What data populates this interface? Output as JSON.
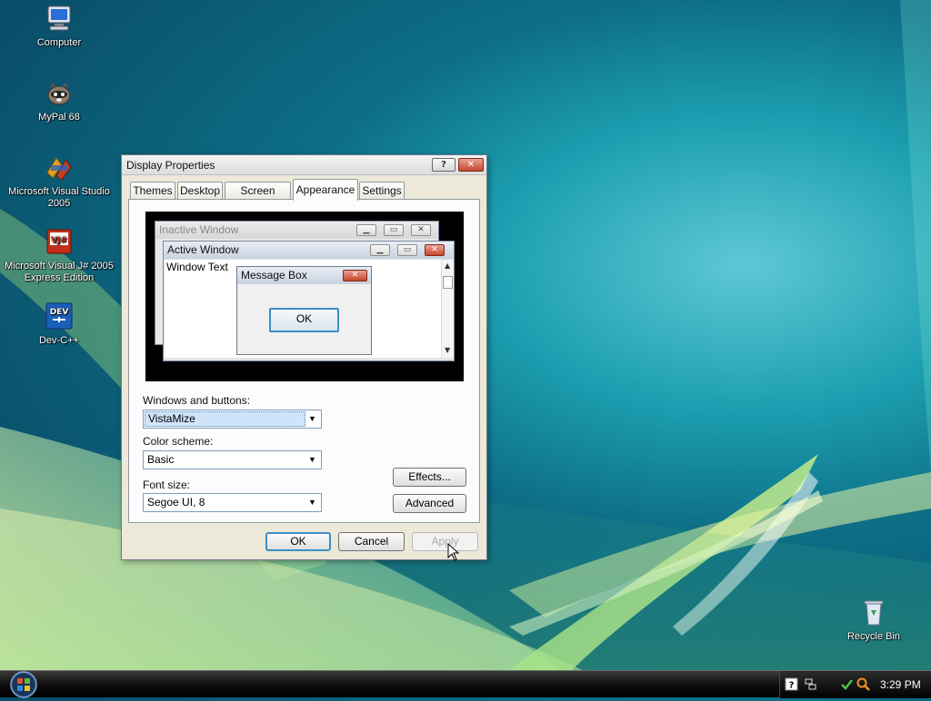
{
  "desktop": {
    "icons": [
      {
        "label": "Computer",
        "icon": "computer-icon"
      },
      {
        "label": "MyPal 68",
        "icon": "mypal-icon"
      },
      {
        "label": "Microsoft Visual Studio 2005",
        "icon": "visual-studio-icon"
      },
      {
        "label": "Microsoft Visual J# 2005 Express Edition",
        "icon": "visual-jsharp-icon",
        "icon_text": "VJ#"
      },
      {
        "label": "Dev-C++",
        "icon": "devcpp-icon",
        "icon_text": "DEV"
      },
      {
        "label": "Recycle Bin",
        "icon": "recycle-bin-icon"
      }
    ]
  },
  "dialog": {
    "title": "Display Properties",
    "help_label": "?",
    "close_label": "✕",
    "tabs": [
      "Themes",
      "Desktop",
      "Screen Saver",
      "Appearance",
      "Settings"
    ],
    "active_tab": "Appearance",
    "preview": {
      "inactive_title": "Inactive Window",
      "active_title": "Active Window",
      "window_text": "Window Text",
      "message_title": "Message Box",
      "message_ok": "OK"
    },
    "windows_buttons_label": "Windows and buttons:",
    "windows_buttons_value": "VistaMize",
    "color_scheme_label": "Color scheme:",
    "color_scheme_value": "Basic",
    "font_size_label": "Font size:",
    "font_size_value": "Segoe UI, 8",
    "effects_label": "Effects...",
    "advanced_label": "Advanced",
    "ok_label": "OK",
    "cancel_label": "Cancel",
    "apply_label": "Apply"
  },
  "taskbar": {
    "clock": "3:29 PM",
    "tray_icons": [
      "help-icon",
      "network-icon",
      "security-icon",
      "search-icon"
    ]
  },
  "colors": {
    "accent": "#3d8ec7",
    "close_red": "#c8442c",
    "dialog_bg": "#ece9d8"
  }
}
